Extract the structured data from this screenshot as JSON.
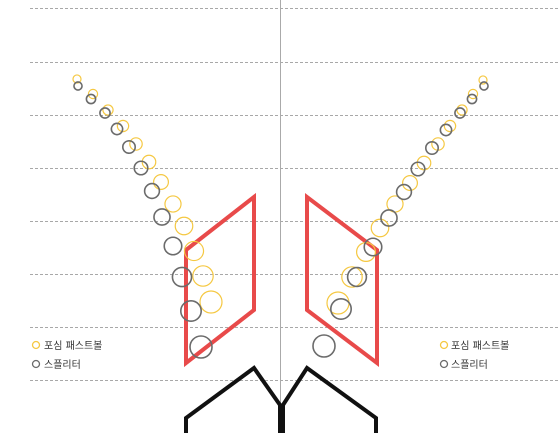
{
  "colors": {
    "fastball": "#f5c842",
    "splitter": "#6b6b6b",
    "zone": "#e84a4a",
    "plate": "#111111",
    "grid": "#8c8c8c",
    "divider": "#aaaaaa"
  },
  "chart_data": [
    {
      "type": "scatter",
      "panel": "left",
      "grid": true,
      "legend_position": "bottom-left",
      "series": [
        {
          "name": "포심 패스트볼",
          "color": "#f5c842",
          "points": [
            {
              "t": 0,
              "x": 77,
              "y": 79,
              "s": 0.13
            },
            {
              "t": 1,
              "x": 93,
              "y": 94,
              "s": 0.2
            },
            {
              "t": 2,
              "x": 108,
              "y": 110,
              "s": 0.26
            },
            {
              "t": 3,
              "x": 123,
              "y": 126,
              "s": 0.33
            },
            {
              "t": 4,
              "x": 136,
              "y": 144,
              "s": 0.4
            },
            {
              "t": 5,
              "x": 149,
              "y": 162,
              "s": 0.47
            },
            {
              "t": 6,
              "x": 161,
              "y": 182,
              "s": 0.55
            },
            {
              "t": 7,
              "x": 173,
              "y": 204,
              "s": 0.63
            },
            {
              "t": 8,
              "x": 184,
              "y": 226,
              "s": 0.72
            },
            {
              "t": 9,
              "x": 194,
              "y": 251,
              "s": 0.82
            },
            {
              "t": 10,
              "x": 203,
              "y": 276,
              "s": 0.9
            },
            {
              "t": 11,
              "x": 211,
              "y": 302,
              "s": 1.0
            }
          ]
        },
        {
          "name": "스플리터",
          "color": "#6b6b6b",
          "points": [
            {
              "t": 0,
              "x": 78,
              "y": 86,
              "s": 0.13
            },
            {
              "t": 1,
              "x": 91,
              "y": 99,
              "s": 0.2
            },
            {
              "t": 2,
              "x": 105,
              "y": 113,
              "s": 0.26
            },
            {
              "t": 3,
              "x": 117,
              "y": 129,
              "s": 0.33
            },
            {
              "t": 4,
              "x": 129,
              "y": 147,
              "s": 0.4
            },
            {
              "t": 5,
              "x": 141,
              "y": 168,
              "s": 0.47
            },
            {
              "t": 6,
              "x": 152,
              "y": 191,
              "s": 0.55
            },
            {
              "t": 7,
              "x": 162,
              "y": 217,
              "s": 0.63
            },
            {
              "t": 8,
              "x": 173,
              "y": 246,
              "s": 0.72
            },
            {
              "t": 9,
              "x": 182,
              "y": 277,
              "s": 0.82
            },
            {
              "t": 10,
              "x": 191,
              "y": 311,
              "s": 0.9
            },
            {
              "t": 11,
              "x": 201,
              "y": 347,
              "s": 1.0
            }
          ]
        }
      ],
      "legend": [
        "포심 패스트볼",
        "스플리터"
      ]
    },
    {
      "type": "scatter",
      "panel": "right",
      "grid": true,
      "legend_position": "bottom-right",
      "series": [
        {
          "name": "포심 패스트볼",
          "color": "#f5c842",
          "points": [
            {
              "t": 0,
              "x": 483,
              "y": 80,
              "s": 0.13
            },
            {
              "t": 1,
              "x": 473,
              "y": 94,
              "s": 0.2
            },
            {
              "t": 2,
              "x": 462,
              "y": 110,
              "s": 0.26
            },
            {
              "t": 3,
              "x": 450,
              "y": 126,
              "s": 0.33
            },
            {
              "t": 4,
              "x": 438,
              "y": 144,
              "s": 0.4
            },
            {
              "t": 5,
              "x": 424,
              "y": 163,
              "s": 0.47
            },
            {
              "t": 6,
              "x": 410,
              "y": 183,
              "s": 0.55
            },
            {
              "t": 7,
              "x": 395,
              "y": 204,
              "s": 0.63
            },
            {
              "t": 8,
              "x": 380,
              "y": 228,
              "s": 0.72
            },
            {
              "t": 9,
              "x": 366,
              "y": 252,
              "s": 0.8
            },
            {
              "t": 10,
              "x": 352,
              "y": 277,
              "s": 0.9
            },
            {
              "t": 11,
              "x": 338,
              "y": 303,
              "s": 1.0
            }
          ]
        },
        {
          "name": "스플리터",
          "color": "#6b6b6b",
          "points": [
            {
              "t": 0,
              "x": 484,
              "y": 86,
              "s": 0.13
            },
            {
              "t": 1,
              "x": 472,
              "y": 99,
              "s": 0.2
            },
            {
              "t": 2,
              "x": 460,
              "y": 113,
              "s": 0.26
            },
            {
              "t": 3,
              "x": 446,
              "y": 130,
              "s": 0.33
            },
            {
              "t": 4,
              "x": 432,
              "y": 148,
              "s": 0.4
            },
            {
              "t": 5,
              "x": 418,
              "y": 169,
              "s": 0.47
            },
            {
              "t": 6,
              "x": 404,
              "y": 192,
              "s": 0.55
            },
            {
              "t": 7,
              "x": 389,
              "y": 218,
              "s": 0.63
            },
            {
              "t": 8,
              "x": 373,
              "y": 247,
              "s": 0.72
            },
            {
              "t": 9,
              "x": 357,
              "y": 277,
              "s": 0.8
            },
            {
              "t": 10,
              "x": 341,
              "y": 309,
              "s": 0.9
            },
            {
              "t": 11,
              "x": 324,
              "y": 346,
              "s": 1.0
            }
          ]
        }
      ],
      "legend": [
        "포심 패스트볼",
        "스플리터"
      ]
    }
  ]
}
